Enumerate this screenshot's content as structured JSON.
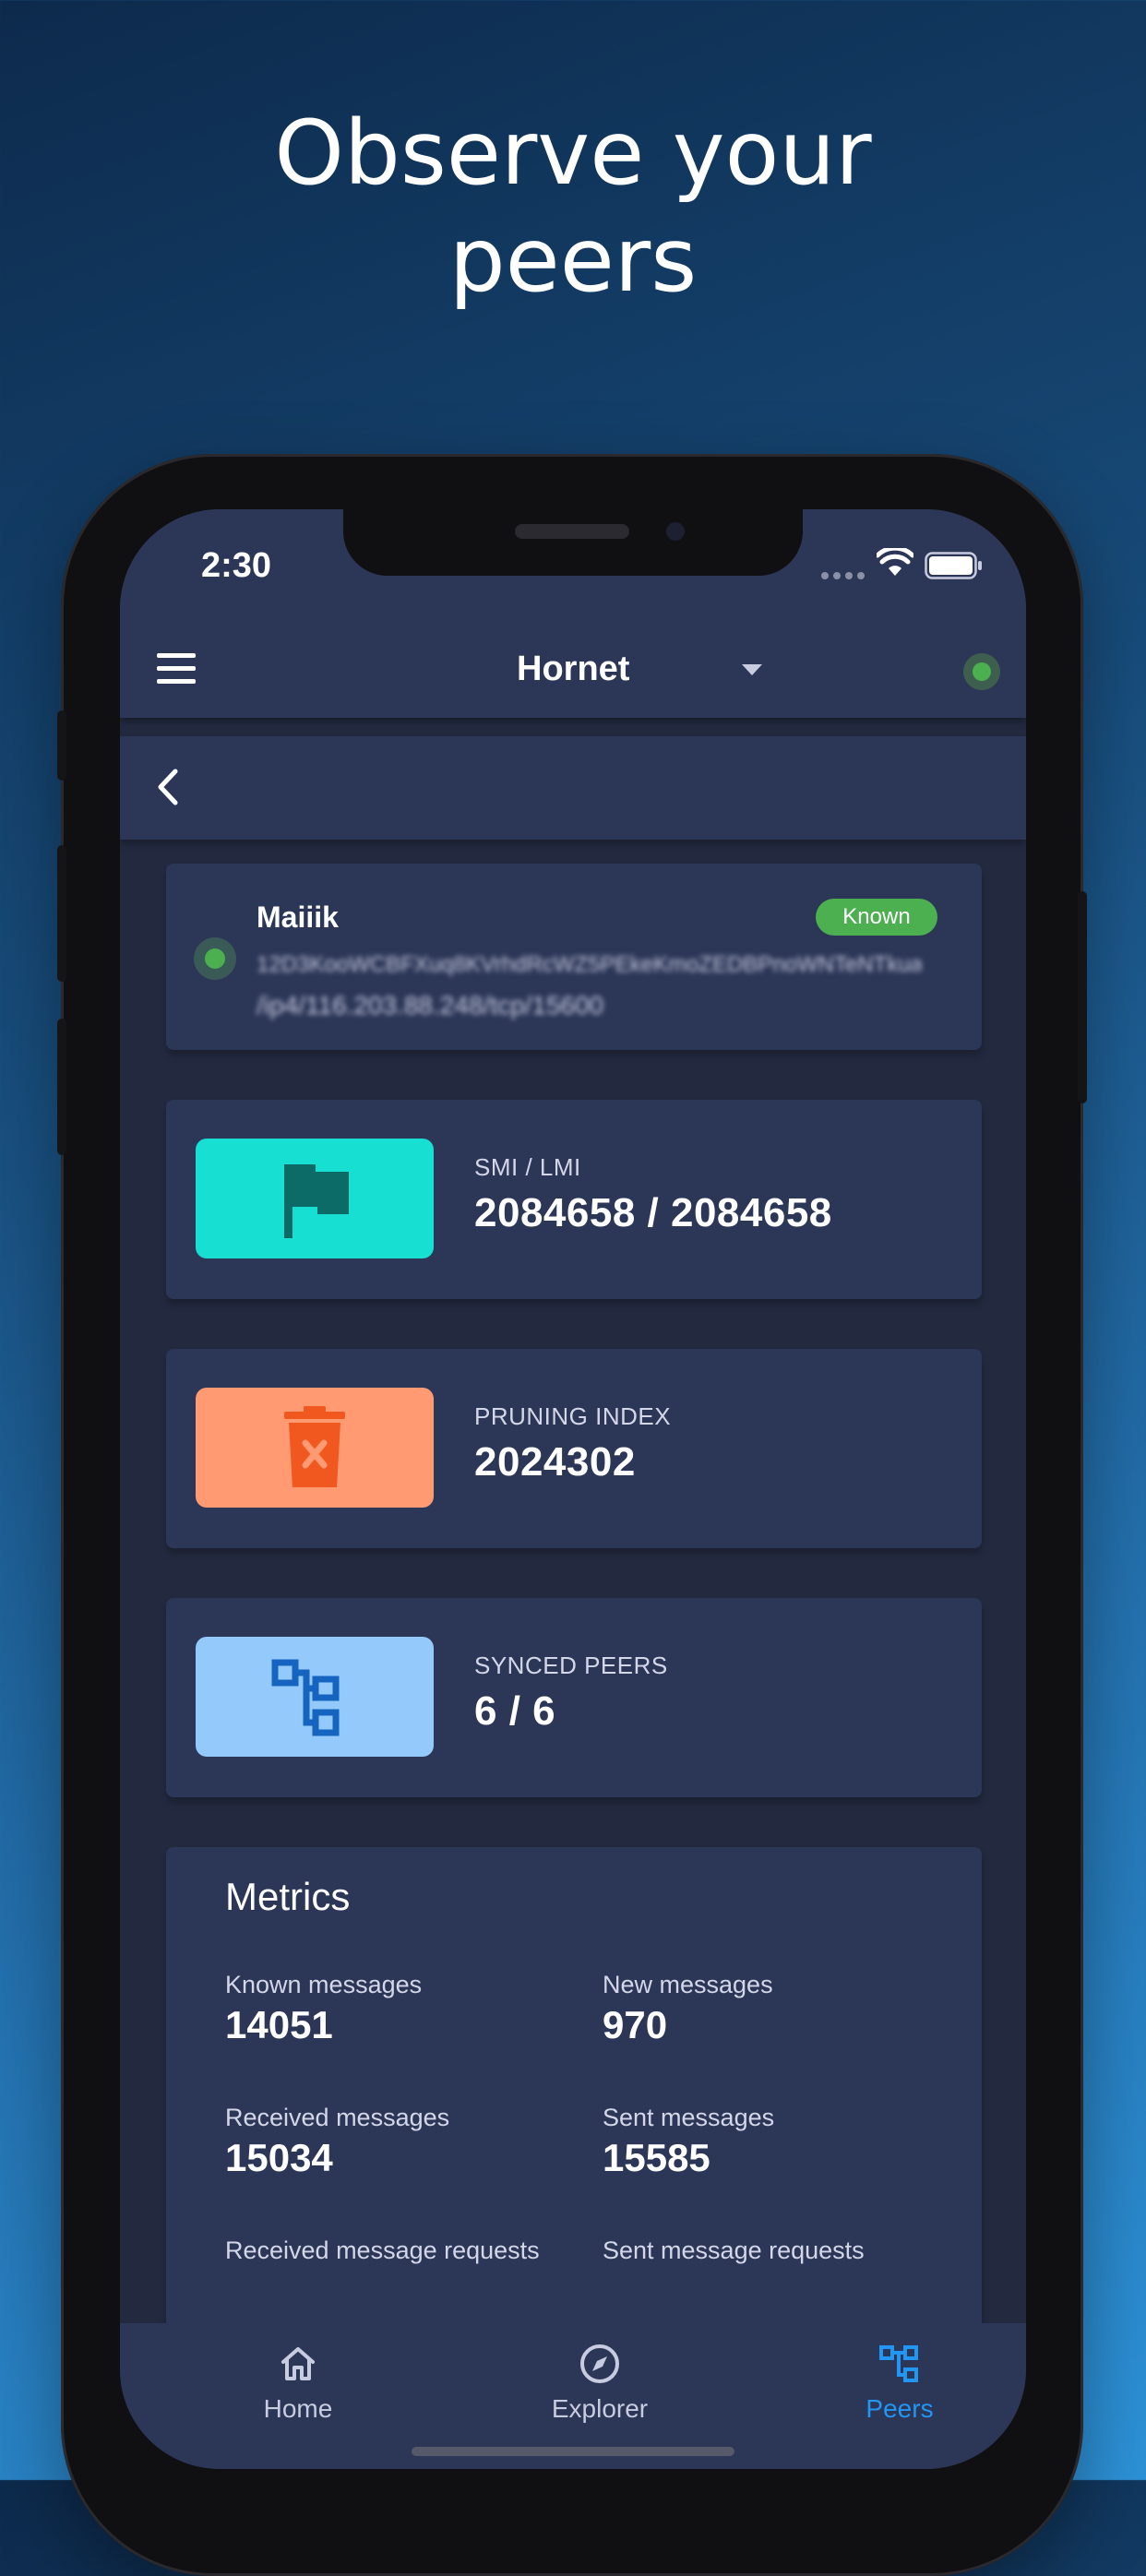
{
  "headline": {
    "line1": "Observe your",
    "line2": "peers"
  },
  "status_bar": {
    "time": "2:30"
  },
  "app_bar": {
    "network_name": "Hornet"
  },
  "peer": {
    "name": "Maiiik",
    "status_badge": "Known",
    "id_blurred": "12D3KooWCBFXuq8KVrhdRcWZ5PEkeKmoZEDBPnoWNTeNTkuaRN",
    "address_blurred": "/ip4/116.203.88.248/tcp/15600"
  },
  "stats": [
    {
      "label": "SMI / LMI",
      "value": "2084658 / 2084658",
      "icon": "flag-icon",
      "color": "#17e0d2"
    },
    {
      "label": "PRUNING INDEX",
      "value": "2024302",
      "icon": "trash-icon",
      "color": "#ff9a72"
    },
    {
      "label": "SYNCED PEERS",
      "value": "6 / 6",
      "icon": "peers-network-icon",
      "color": "#93c9fb"
    }
  ],
  "metrics": {
    "title": "Metrics",
    "items": [
      {
        "label": "Known messages",
        "value": "14051"
      },
      {
        "label": "New messages",
        "value": "970"
      },
      {
        "label": "Received messages",
        "value": "15034"
      },
      {
        "label": "Sent messages",
        "value": "15585"
      },
      {
        "label": "Received message requests",
        "value": ""
      },
      {
        "label": "Sent message requests",
        "value": ""
      }
    ]
  },
  "bottom_nav": {
    "home": "Home",
    "explorer": "Explorer",
    "peers": "Peers",
    "active": "peers",
    "active_color": "#2196f3",
    "inactive_color": "#c8cce0"
  }
}
